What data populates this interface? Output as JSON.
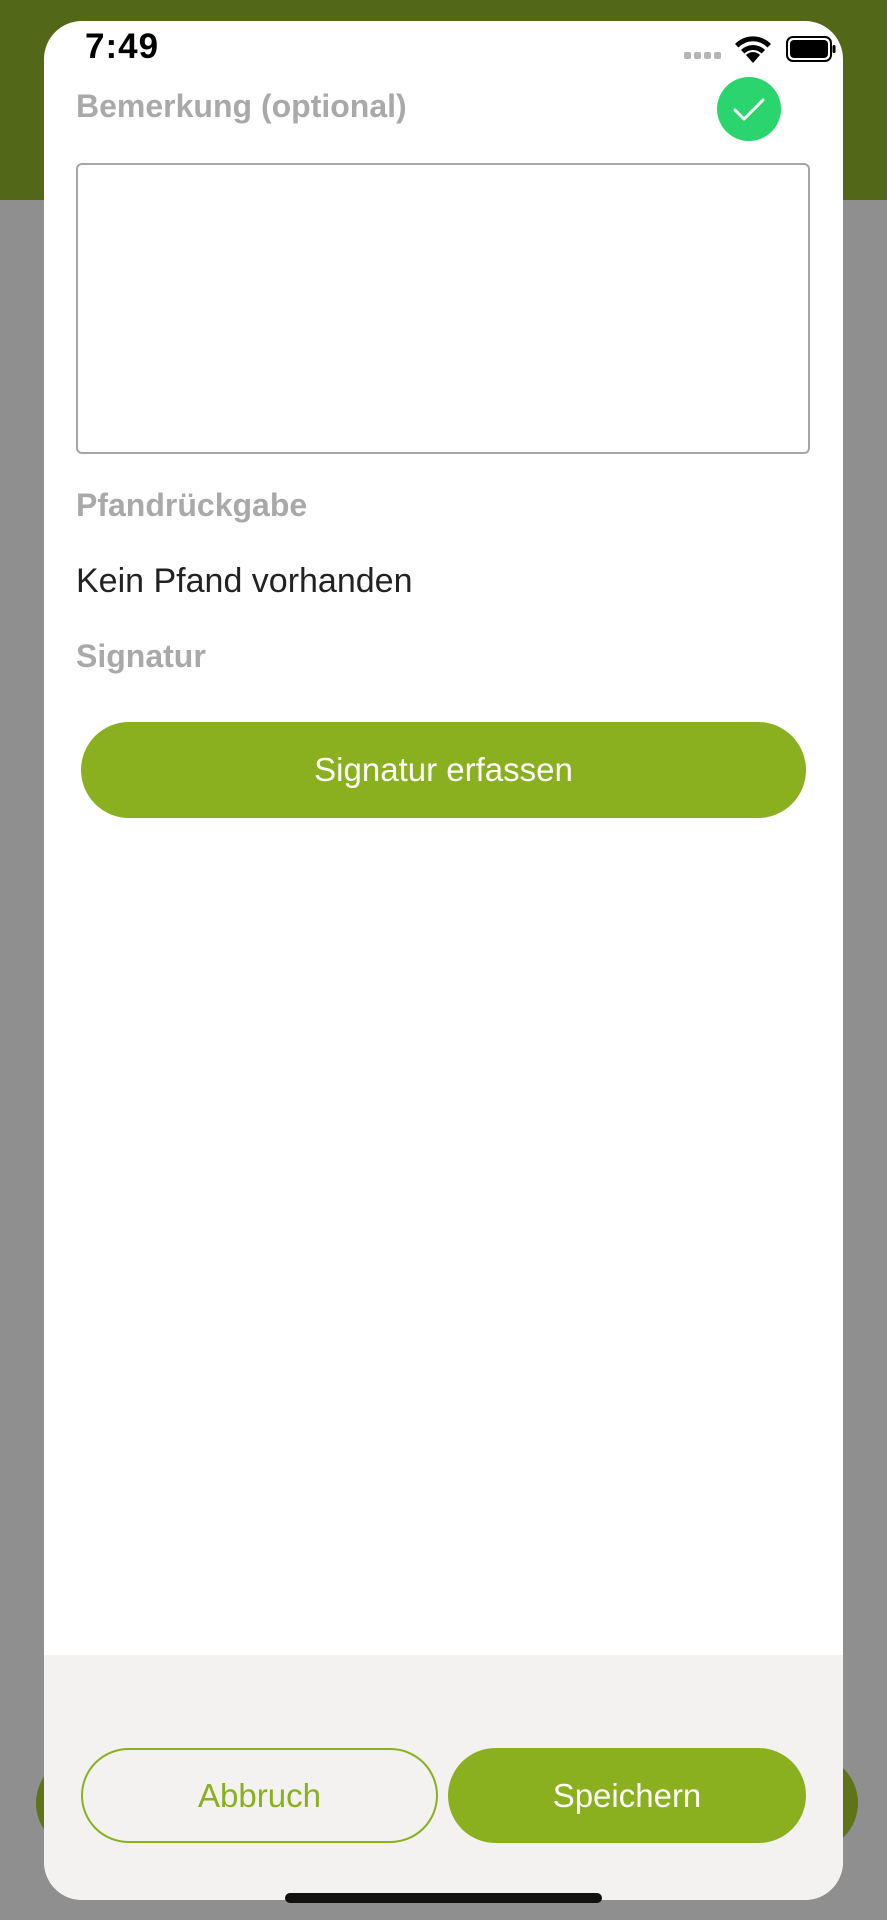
{
  "status_bar": {
    "time": "7:49",
    "signal_icon": "signal-dots-icon",
    "wifi_icon": "wifi-icon",
    "battery_icon": "battery-icon"
  },
  "form": {
    "remark": {
      "label": "Bemerkung (optional)",
      "value": "",
      "placeholder": ""
    },
    "status_icon": "checkmark-circle-icon",
    "deposit": {
      "label": "Pfandrückgabe",
      "value": "Kein Pfand vorhanden"
    },
    "signature": {
      "label": "Signatur",
      "button_label": "Signatur erfassen"
    }
  },
  "footer": {
    "cancel_label": "Abbruch",
    "save_label": "Speichern"
  },
  "colors": {
    "accent": "#8aaf1f",
    "header_band": "#526717",
    "success": "#2bd56e",
    "overlay": "#8f8f8f",
    "label_gray": "#a9a9a9"
  }
}
